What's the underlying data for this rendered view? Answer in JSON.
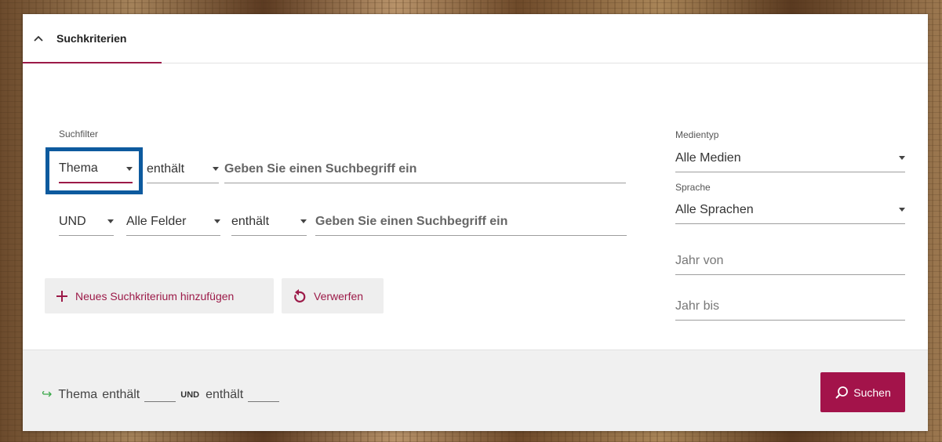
{
  "header": {
    "tab_label": "Suchkriterien"
  },
  "filters": {
    "section_label": "Suchfilter",
    "row1": {
      "field": "Thema",
      "operator": "enthält",
      "placeholder": "Geben Sie einen Suchbegriff ein"
    },
    "row2": {
      "connector": "UND",
      "field": "Alle Felder",
      "operator": "enthält",
      "placeholder": "Geben Sie einen Suchbegriff ein"
    }
  },
  "actions": {
    "add_label": "Neues Suchkriterium hinzufügen",
    "reset_label": "Verwerfen"
  },
  "sidebar": {
    "medientyp_label": "Medientyp",
    "medientyp_value": "Alle Medien",
    "sprache_label": "Sprache",
    "sprache_value": "Alle Sprachen",
    "jahr_von_placeholder": "Jahr von",
    "jahr_bis_placeholder": "Jahr bis"
  },
  "footer": {
    "summary_field": "Thema",
    "summary_op1": "enthält",
    "summary_connector": "UND",
    "summary_op2": "enthält",
    "search_label": "Suchen"
  },
  "colors": {
    "accent": "#9c1a48",
    "highlight": "#0d5a9e",
    "arrow": "#3aa84a"
  },
  "icons": [
    "chevron-up-icon",
    "caret-down-icon",
    "plus-icon",
    "undo-icon",
    "search-icon",
    "arrow-right-icon"
  ]
}
